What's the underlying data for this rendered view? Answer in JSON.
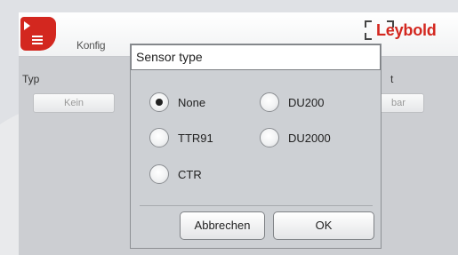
{
  "header": {
    "title": "Konfig",
    "brand": "Leybold",
    "menu_icon": "hamburger-menu-icon",
    "brand_color": "#d3271f"
  },
  "background": {
    "type_label": "Typ",
    "type_value": "Kein",
    "right_value": "bar",
    "right_label_partial": "t"
  },
  "dialog": {
    "title": "Sensor type",
    "options": [
      {
        "label": "None",
        "selected": true
      },
      {
        "label": "DU200",
        "selected": false
      },
      {
        "label": "TTR91",
        "selected": false
      },
      {
        "label": "DU2000",
        "selected": false
      },
      {
        "label": "CTR",
        "selected": false
      }
    ],
    "cancel_label": "Abbrechen",
    "ok_label": "OK"
  }
}
